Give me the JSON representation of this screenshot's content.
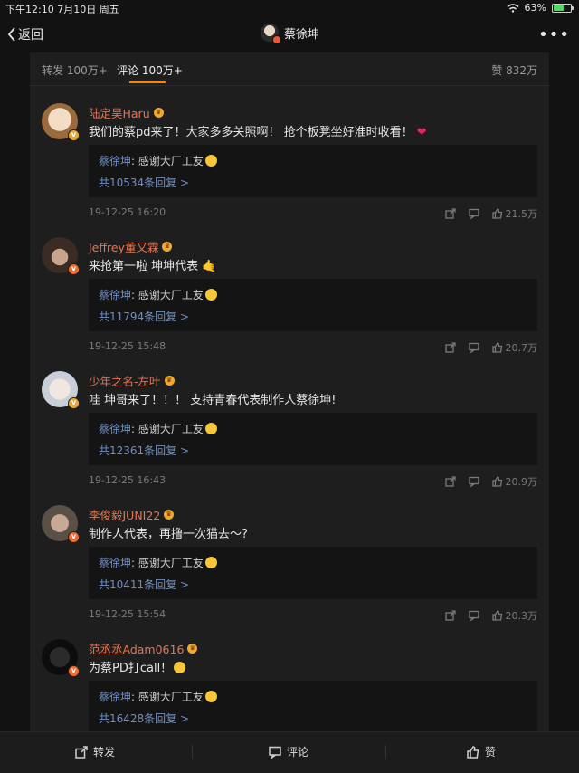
{
  "status": {
    "time_date": "下午12:10   7月10日 周五",
    "battery": "63%",
    "battery_level": 0.63
  },
  "nav": {
    "back_label": "返回",
    "title": "蔡徐坤",
    "more_glyph": "•••"
  },
  "tabs": [
    {
      "label": "转发 100万+"
    },
    {
      "label": "评论 100万+"
    }
  ],
  "likes_total": "赞 832万",
  "comments": [
    {
      "username": "陆定昊Haru",
      "content": "我们的蔡pd来了！大家多多关照啊！ 抢个板凳坐好准时收看！",
      "reply_author": "蔡徐坤",
      "reply_text": ": 感谢大厂工友",
      "reply_count": "共10534条回复 >",
      "time": "19-12-25 16:20",
      "likes": "21.5万"
    },
    {
      "username": "Jeffrey董又霖",
      "content": "来抢第一啦 坤坤代表",
      "reply_author": "蔡徐坤",
      "reply_text": ": 感谢大厂工友",
      "reply_count": "共11794条回复 >",
      "time": "19-12-25 15:48",
      "likes": "20.7万"
    },
    {
      "username": "少年之名-左叶",
      "content": "哇 坤哥来了！！！ 支持青春代表制作人蔡徐坤!",
      "reply_author": "蔡徐坤",
      "reply_text": ": 感谢大厂工友",
      "reply_count": "共12361条回复 >",
      "time": "19-12-25 16:43",
      "likes": "20.9万"
    },
    {
      "username": "李俊毅JUNI22",
      "content": "制作人代表，再撸一次猫去～?",
      "reply_author": "蔡徐坤",
      "reply_text": ": 感谢大厂工友",
      "reply_count": "共10411条回复 >",
      "time": "19-12-25 15:54",
      "likes": "20.3万"
    },
    {
      "username": "范丞丞Adam0616",
      "content": "为蔡PD打call！",
      "reply_author": "蔡徐坤",
      "reply_text": ": 感谢大厂工友",
      "reply_count": "共16428条回复 >",
      "time": "",
      "likes": ""
    }
  ],
  "bottom_bar": {
    "repost": "转发",
    "comment": "评论",
    "like": "赞"
  },
  "colors": {
    "accent": "#ff8200",
    "username": "#eb7350",
    "link": "#6d8fc4"
  }
}
